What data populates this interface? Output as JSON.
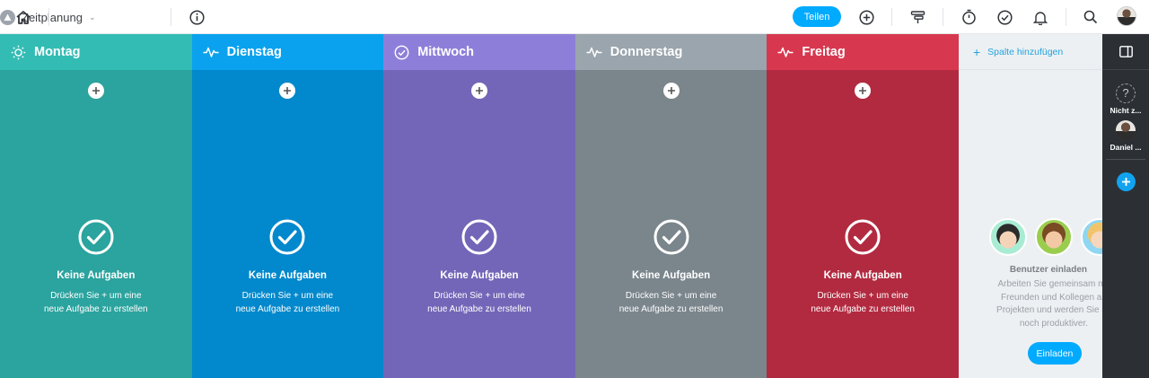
{
  "header": {
    "project_name": "Zeitplanung",
    "share_label": "Teilen",
    "icons": [
      "home-icon",
      "project-icon",
      "info-icon",
      "add-icon",
      "timeline-icon",
      "timer-icon",
      "check-icon",
      "bell-icon",
      "search-icon",
      "avatar"
    ]
  },
  "columns": [
    {
      "title": "Montag",
      "icon": "sun-icon",
      "color": "#2ba39e",
      "head_color": "#33bcb4"
    },
    {
      "title": "Dienstag",
      "icon": "pulse-icon",
      "color": "#0288cc",
      "head_color": "#0aa2ee"
    },
    {
      "title": "Mittwoch",
      "icon": "check-circle-icon",
      "color": "#7366b8",
      "head_color": "#8d7fd9"
    },
    {
      "title": "Donnerstag",
      "icon": "pulse-icon",
      "color": "#7a858c",
      "head_color": "#9aa5ad"
    },
    {
      "title": "Freitag",
      "icon": "pulse-icon",
      "color": "#b22a40",
      "head_color": "#d7384f"
    }
  ],
  "empty_state": {
    "title": "Keine Aufgaben",
    "description": "Drücken Sie + um eine\nneue Aufgabe zu erstellen"
  },
  "add_column": {
    "label": "Spalte hinzufügen",
    "invite_title": "Benutzer einladen",
    "invite_desc": "Arbeiten Sie gemeinsam mit\nFreunden und Kollegen an\nProjekten und werden Sie so\nnoch produktiver.",
    "invite_button": "Einladen"
  },
  "sidebar": {
    "users": [
      {
        "name": "Nicht z...",
        "icon": "unassigned-icon"
      },
      {
        "name": "Daniel ...",
        "icon": "avatar"
      }
    ]
  }
}
